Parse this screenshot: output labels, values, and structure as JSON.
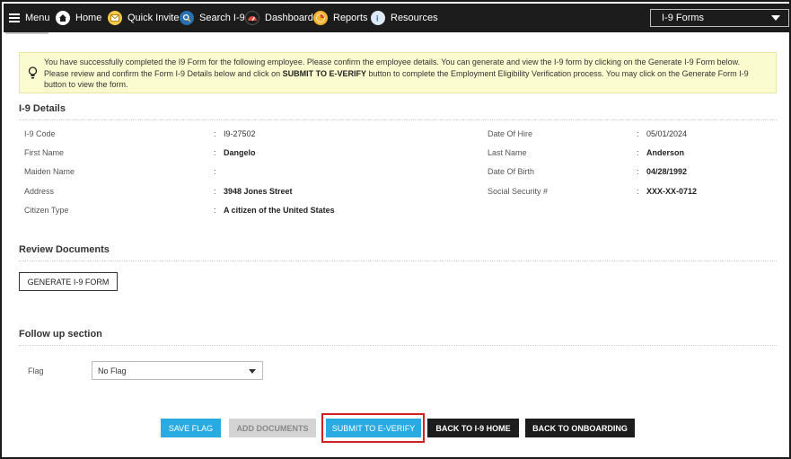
{
  "nav": {
    "menu_label": "Menu",
    "items": [
      {
        "label": "Home",
        "icon": "home-icon"
      },
      {
        "label": "Quick Invite",
        "icon": "invite-icon"
      },
      {
        "label": "Search I-9",
        "icon": "search-icon"
      },
      {
        "label": "Dashboard",
        "icon": "dashboard-icon"
      },
      {
        "label": "Reports",
        "icon": "reports-icon"
      },
      {
        "label": "Resources",
        "icon": "resources-icon"
      }
    ],
    "form_select": "I-9 Forms"
  },
  "alert": {
    "line1": "You have successfully completed the I9 Form for the following employee. Please confirm the employee details. You can generate and view the I-9 form by clicking on the Generate I-9 Form below.",
    "line2_prefix": "Please review and confirm the Form I-9 Details below and click on ",
    "line2_bold": "SUBMIT TO E-VERIFY",
    "line2_suffix": " button to complete the Employment Eligibility Verification process. You may click on the Generate Form I-9 button to view the form."
  },
  "details": {
    "title": "I-9 Details",
    "left": [
      {
        "label": "I-9 Code",
        "value": "I9-27502"
      },
      {
        "label": "First Name",
        "value": "Dangelo"
      },
      {
        "label": "Maiden Name",
        "value": ""
      },
      {
        "label": "Address",
        "value": "3948 Jones Street"
      },
      {
        "label": "Citizen Type",
        "value": "A citizen of the United States"
      }
    ],
    "right": [
      {
        "label": "Date Of Hire",
        "value": "05/01/2024"
      },
      {
        "label": "Last Name",
        "value": "Anderson"
      },
      {
        "label": "Date Of Birth",
        "value": "04/28/1992"
      },
      {
        "label": "Social Security #",
        "value": "XXX-XX-0712"
      }
    ],
    "colon": ":"
  },
  "review": {
    "title": "Review Documents",
    "generate_label": "GENERATE I-9 FORM"
  },
  "followup": {
    "title": "Follow up section",
    "flag_label": "Flag",
    "flag_value": "No Flag"
  },
  "actions": {
    "save_flag": "SAVE FLAG",
    "add_documents": "ADD DOCUMENTS",
    "submit": "SUBMIT TO E-VERIFY",
    "back_i9": "BACK TO I-9 HOME",
    "back_onboarding": "BACK TO ONBOARDING"
  },
  "colors": {
    "nav_bg": "#1c1c1c",
    "primary": "#29abe2",
    "alert_bg": "#fbfbd0",
    "highlight": "#d32020"
  }
}
